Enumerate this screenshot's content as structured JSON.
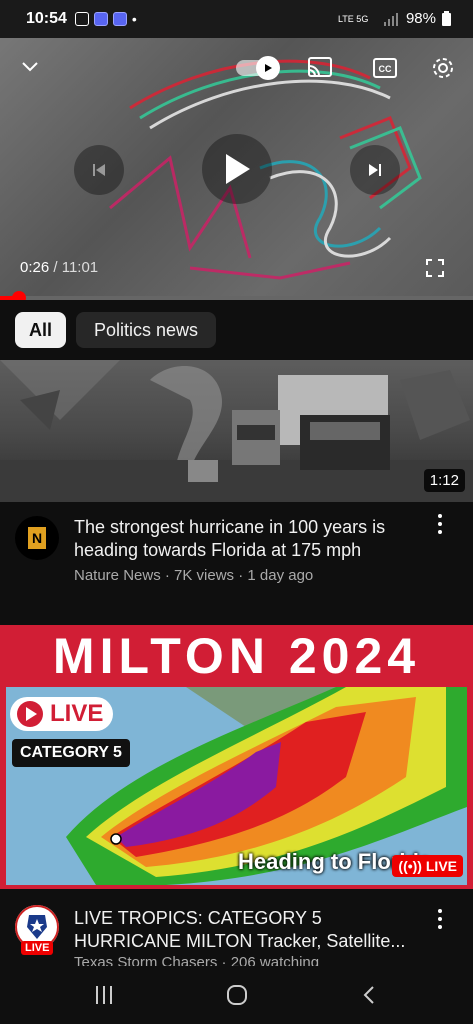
{
  "status_bar": {
    "time": "10:54",
    "signal": "LTE 5G",
    "battery": "98%",
    "icons": [
      "image-icon",
      "qr-icon",
      "qr-icon",
      "dot-icon",
      "volte-icon",
      "5g-icon",
      "signal-icon",
      "battery-icon"
    ]
  },
  "player": {
    "current_time": "0:26",
    "separator": " / ",
    "duration": "11:01",
    "progress_fraction": 0.04
  },
  "chips": [
    {
      "label": "All",
      "active": true
    },
    {
      "label": "Politics news",
      "active": false
    }
  ],
  "videos": [
    {
      "duration": "1:12",
      "title": "The strongest hurricane in 100 years is heading towards Florida at 175 mph",
      "channel": "Nature News",
      "meta": "Nature News · 7K views · 1 day ago",
      "avatar_letter": "N"
    },
    {
      "thumb_title": "MILTON 2024",
      "thumb_live": "LIVE",
      "thumb_category": "CATEGORY 5",
      "thumb_heading": "Heading to Florida",
      "thumb_live_small": "LIVE",
      "title": "LIVE TROPICS: CATEGORY 5 HURRICANE MILTON Tracker, Satellite...",
      "meta": "Texas Storm Chasers · 206 watching",
      "avatar_badge": "LIVE"
    }
  ],
  "colors": {
    "background": "#0f0f0f",
    "accent_red": "#ff0000",
    "chip_active": "#f1f1f1",
    "chip_inactive": "#272727",
    "meta_gray": "#aaaaaa",
    "thumb_red": "#d11e35"
  }
}
